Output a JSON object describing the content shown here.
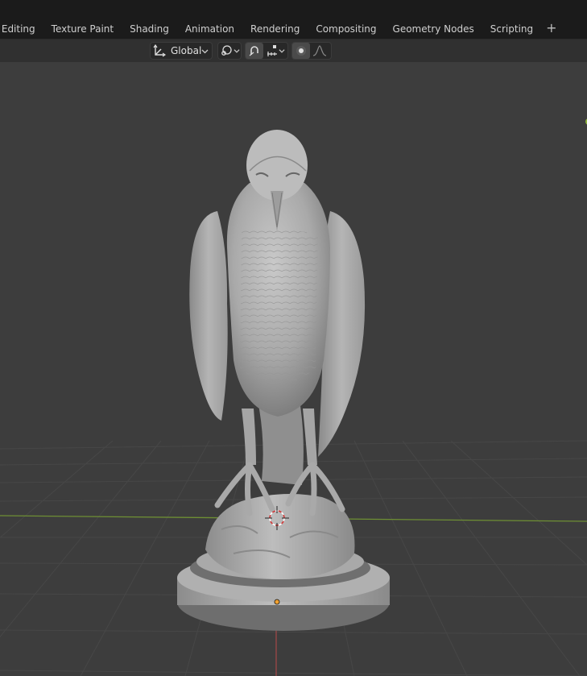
{
  "workspace_tabs": [
    {
      "label": "/ Editing"
    },
    {
      "label": "Texture Paint"
    },
    {
      "label": "Shading"
    },
    {
      "label": "Animation"
    },
    {
      "label": "Rendering"
    },
    {
      "label": "Compositing"
    },
    {
      "label": "Geometry Nodes"
    },
    {
      "label": "Scripting"
    }
  ],
  "add_workspace_symbol": "+",
  "header": {
    "transform_orientation": "Global",
    "transform_orientation_icon": "transform-orientation-icon",
    "pivot_icon": "pivot-point-icon",
    "snap_icon": "snap-magnet-icon",
    "snap_target_icon": "snap-increment-icon",
    "proportional_edit_icon": "proportional-editing-icon",
    "falloff_icon": "falloff-curve-icon"
  },
  "viewport": {
    "background": "#3d3d3d",
    "grid_color": "#4a4a4a",
    "x_axis_color": "#7a9a3a",
    "z_axis_color": "#a84a4a",
    "model": "falcon-statue-on-pedestal",
    "origin_color": "#f0a030"
  }
}
